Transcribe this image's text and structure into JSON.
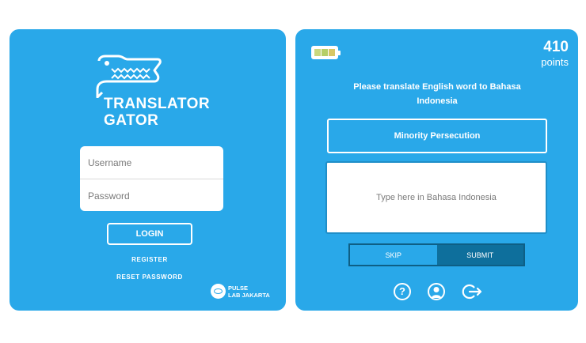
{
  "login": {
    "logo_line1": "TRANSLATOR",
    "logo_line2": "GATOR",
    "username_placeholder": "Username",
    "password_placeholder": "Password",
    "login_button": "LOGIN",
    "register_link": "REGISTER",
    "reset_link": "RESET PASSWORD",
    "partner_line1": "PULSE",
    "partner_line2": "LAB JAKARTA"
  },
  "game": {
    "score": "410",
    "score_label": "points",
    "instruction": "Please translate English word to Bahasa Indonesia",
    "word": "Minority Persecution",
    "answer_placeholder": "Type here in Bahasa Indonesia",
    "skip_button": "SKIP",
    "submit_button": "SUBMIT",
    "battery_colors": [
      "#c9d87e",
      "#b6cf67",
      "#d8c765"
    ],
    "icons": [
      "help-icon",
      "profile-icon",
      "logout-icon"
    ],
    "accent_color": "#29a8e9"
  }
}
